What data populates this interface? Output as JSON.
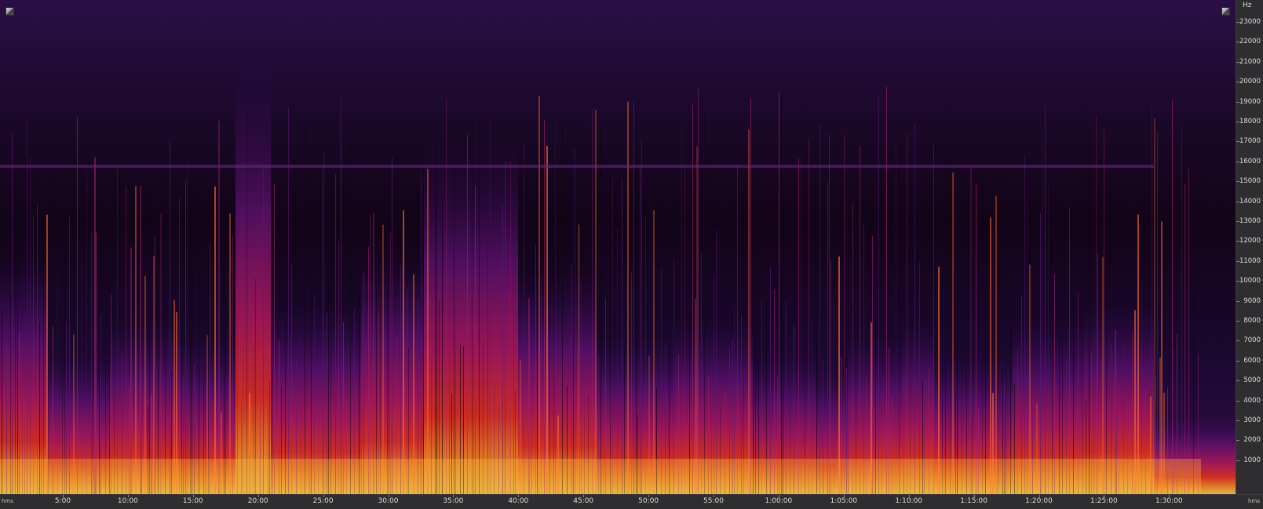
{
  "spectrogram": {
    "frequency_unit": "Hz",
    "frequency_labels": [
      "23000",
      "22000",
      "21000",
      "20000",
      "19000",
      "18000",
      "17000",
      "16000",
      "15000",
      "14000",
      "13000",
      "12000",
      "11000",
      "10000",
      "9000",
      "8000",
      "7000",
      "6000",
      "5000",
      "4000",
      "3000",
      "2000",
      "1000"
    ],
    "time_labels": [
      "5:00",
      "10:00",
      "15:00",
      "20:00",
      "25:00",
      "30:00",
      "35:00",
      "40:00",
      "45:00",
      "50:00",
      "55:00",
      "1:00:00",
      "1:05:00",
      "1:10:00",
      "1:15:00",
      "1:20:00",
      "1:25:00",
      "1:30:00"
    ],
    "time_start_label": "hms",
    "time_end_label": "hms",
    "colors": {
      "background": "#12061c",
      "low": "#2a0a4a",
      "mid": "#8a1a6a",
      "high": "#e8321e",
      "peak": "#ffd04a"
    }
  }
}
